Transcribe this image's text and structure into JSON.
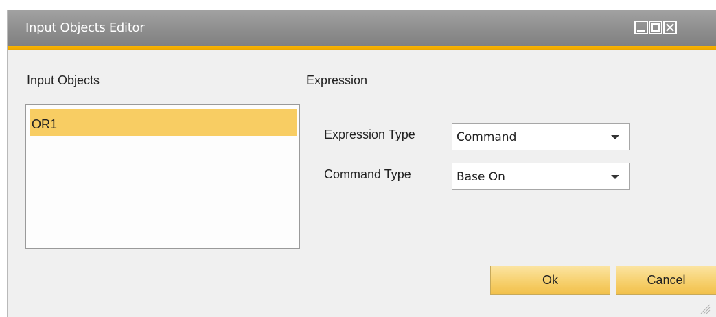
{
  "window": {
    "title": "Input Objects Editor",
    "controls": [
      "minimize-icon",
      "maximize-icon",
      "close-icon"
    ]
  },
  "left_panel": {
    "heading": "Input Objects",
    "items": [
      {
        "label": "OR1",
        "selected": true
      }
    ]
  },
  "right_panel": {
    "heading": "Expression",
    "expression_type": {
      "label": "Expression Type",
      "value": "Command"
    },
    "command_type": {
      "label": "Command Type",
      "value": "Base On"
    }
  },
  "buttons": {
    "ok_label": "Ok",
    "cancel_label": "Cancel"
  },
  "colors": {
    "title_bar": "#8e8e8e",
    "accent": "#f3b100",
    "selection": "#f8cd63",
    "button": "#f7d272"
  }
}
